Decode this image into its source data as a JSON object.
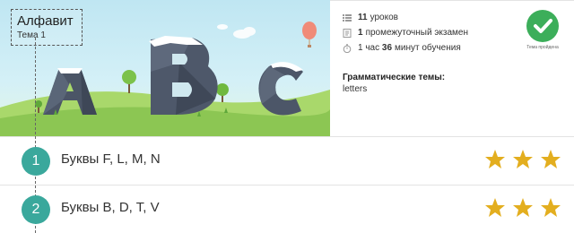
{
  "course": {
    "title": "Алфавит",
    "subtitle": "Тема 1",
    "banner_letters": [
      "A",
      "B",
      "C"
    ]
  },
  "info": {
    "lessons_count": "11",
    "lessons_label": "уроков",
    "exam_count": "1",
    "exam_label": "промежуточный экзамен",
    "time_hours": "1",
    "time_hours_label": "час",
    "time_minutes": "36",
    "time_minutes_label": "минут обучения",
    "grammar_title": "Грамматические темы:",
    "grammar_value": "letters",
    "status_label": "Тема пройдена",
    "status_color": "#3cae5a"
  },
  "lessons": [
    {
      "number": "1",
      "title": "Буквы F, L, M, N",
      "stars": 3
    },
    {
      "number": "2",
      "title": "Буквы B, D, T, V",
      "stars": 3
    }
  ],
  "colors": {
    "accent": "#3aa89c",
    "star": "#e3ae1f"
  }
}
